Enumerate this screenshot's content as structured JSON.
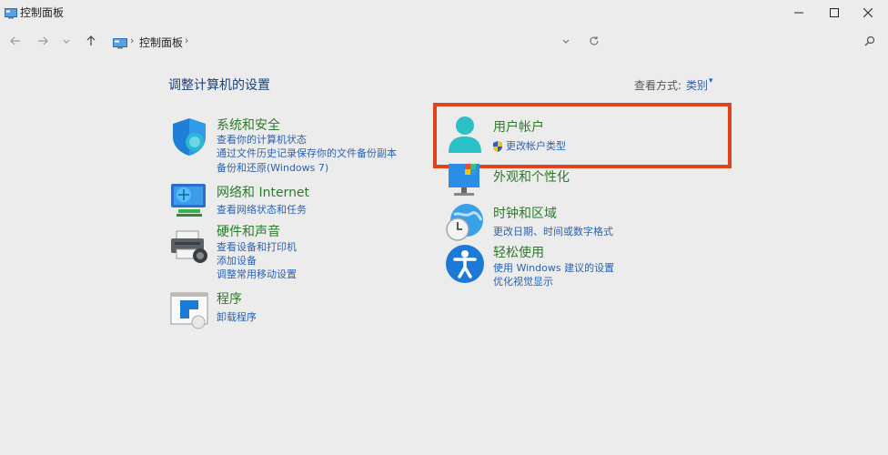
{
  "window": {
    "title": "控制面板",
    "buttons": {
      "minimize": "minimize-icon",
      "maximize": "maximize-icon",
      "close": "close-icon"
    }
  },
  "address": {
    "breadcrumb": [
      "控制面板"
    ],
    "separator": "›"
  },
  "main": {
    "heading": "调整计算机的设置",
    "view_by_label": "查看方式:",
    "view_by_value": "类别",
    "view_by_caret": "▾",
    "left_categories": [
      {
        "title": "系统和安全",
        "icon": "shield-icon",
        "links": [
          "查看你的计算机状态",
          "通过文件历史记录保存你的文件备份副本",
          "备份和还原(Windows 7)"
        ]
      },
      {
        "title": "网络和 Internet",
        "icon": "network-icon",
        "links": [
          "查看网络状态和任务"
        ]
      },
      {
        "title": "硬件和声音",
        "icon": "printer-icon",
        "links": [
          "查看设备和打印机",
          "添加设备",
          "调整常用移动设置"
        ]
      },
      {
        "title": "程序",
        "icon": "programs-icon",
        "links": [
          "卸载程序"
        ]
      }
    ],
    "right_categories": [
      {
        "title": "用户帐户",
        "icon": "user-icon",
        "links": [
          "更改帐户类型"
        ]
      },
      {
        "title": "外观和个性化",
        "icon": "appearance-icon",
        "links": []
      },
      {
        "title": "时钟和区域",
        "icon": "clock-globe-icon",
        "links": [
          "更改日期、时间或数字格式"
        ]
      },
      {
        "title": "轻松使用",
        "icon": "accessibility-icon",
        "links": [
          "使用 Windows 建议的设置",
          "优化视觉显示"
        ]
      }
    ]
  },
  "colors": {
    "category_title": "#2c7a2c",
    "link": "#2a62b8",
    "heading": "#1e3f73",
    "highlight": "#e0431e",
    "background": "#ececec"
  }
}
